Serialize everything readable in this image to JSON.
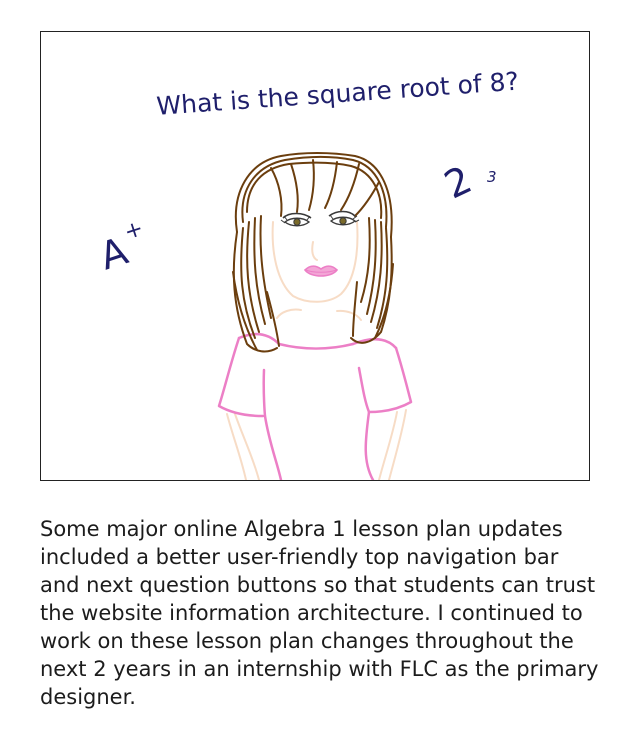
{
  "illustration": {
    "question": "What is the square root of 8?",
    "grade": "A",
    "grade_mark": "+",
    "power_base": "2",
    "power_exponent": "3",
    "colors": {
      "frame_border": "#222222",
      "handwriting": "#1f1f6b",
      "hair": "#6b3e0e",
      "shirt": "#ec7fc6",
      "skin_outline": "#f7dcc6",
      "lips": "#ec7fc6",
      "eyes": "#3a3a3a"
    }
  },
  "caption": {
    "text": "Some major online Algebra 1 lesson plan updates included a better user-friendly top navigation bar and next question buttons so that students can trust the website information architecture. I continued to work on these lesson plan changes throughout the next 2 years in an internship with FLC as the primary designer."
  }
}
